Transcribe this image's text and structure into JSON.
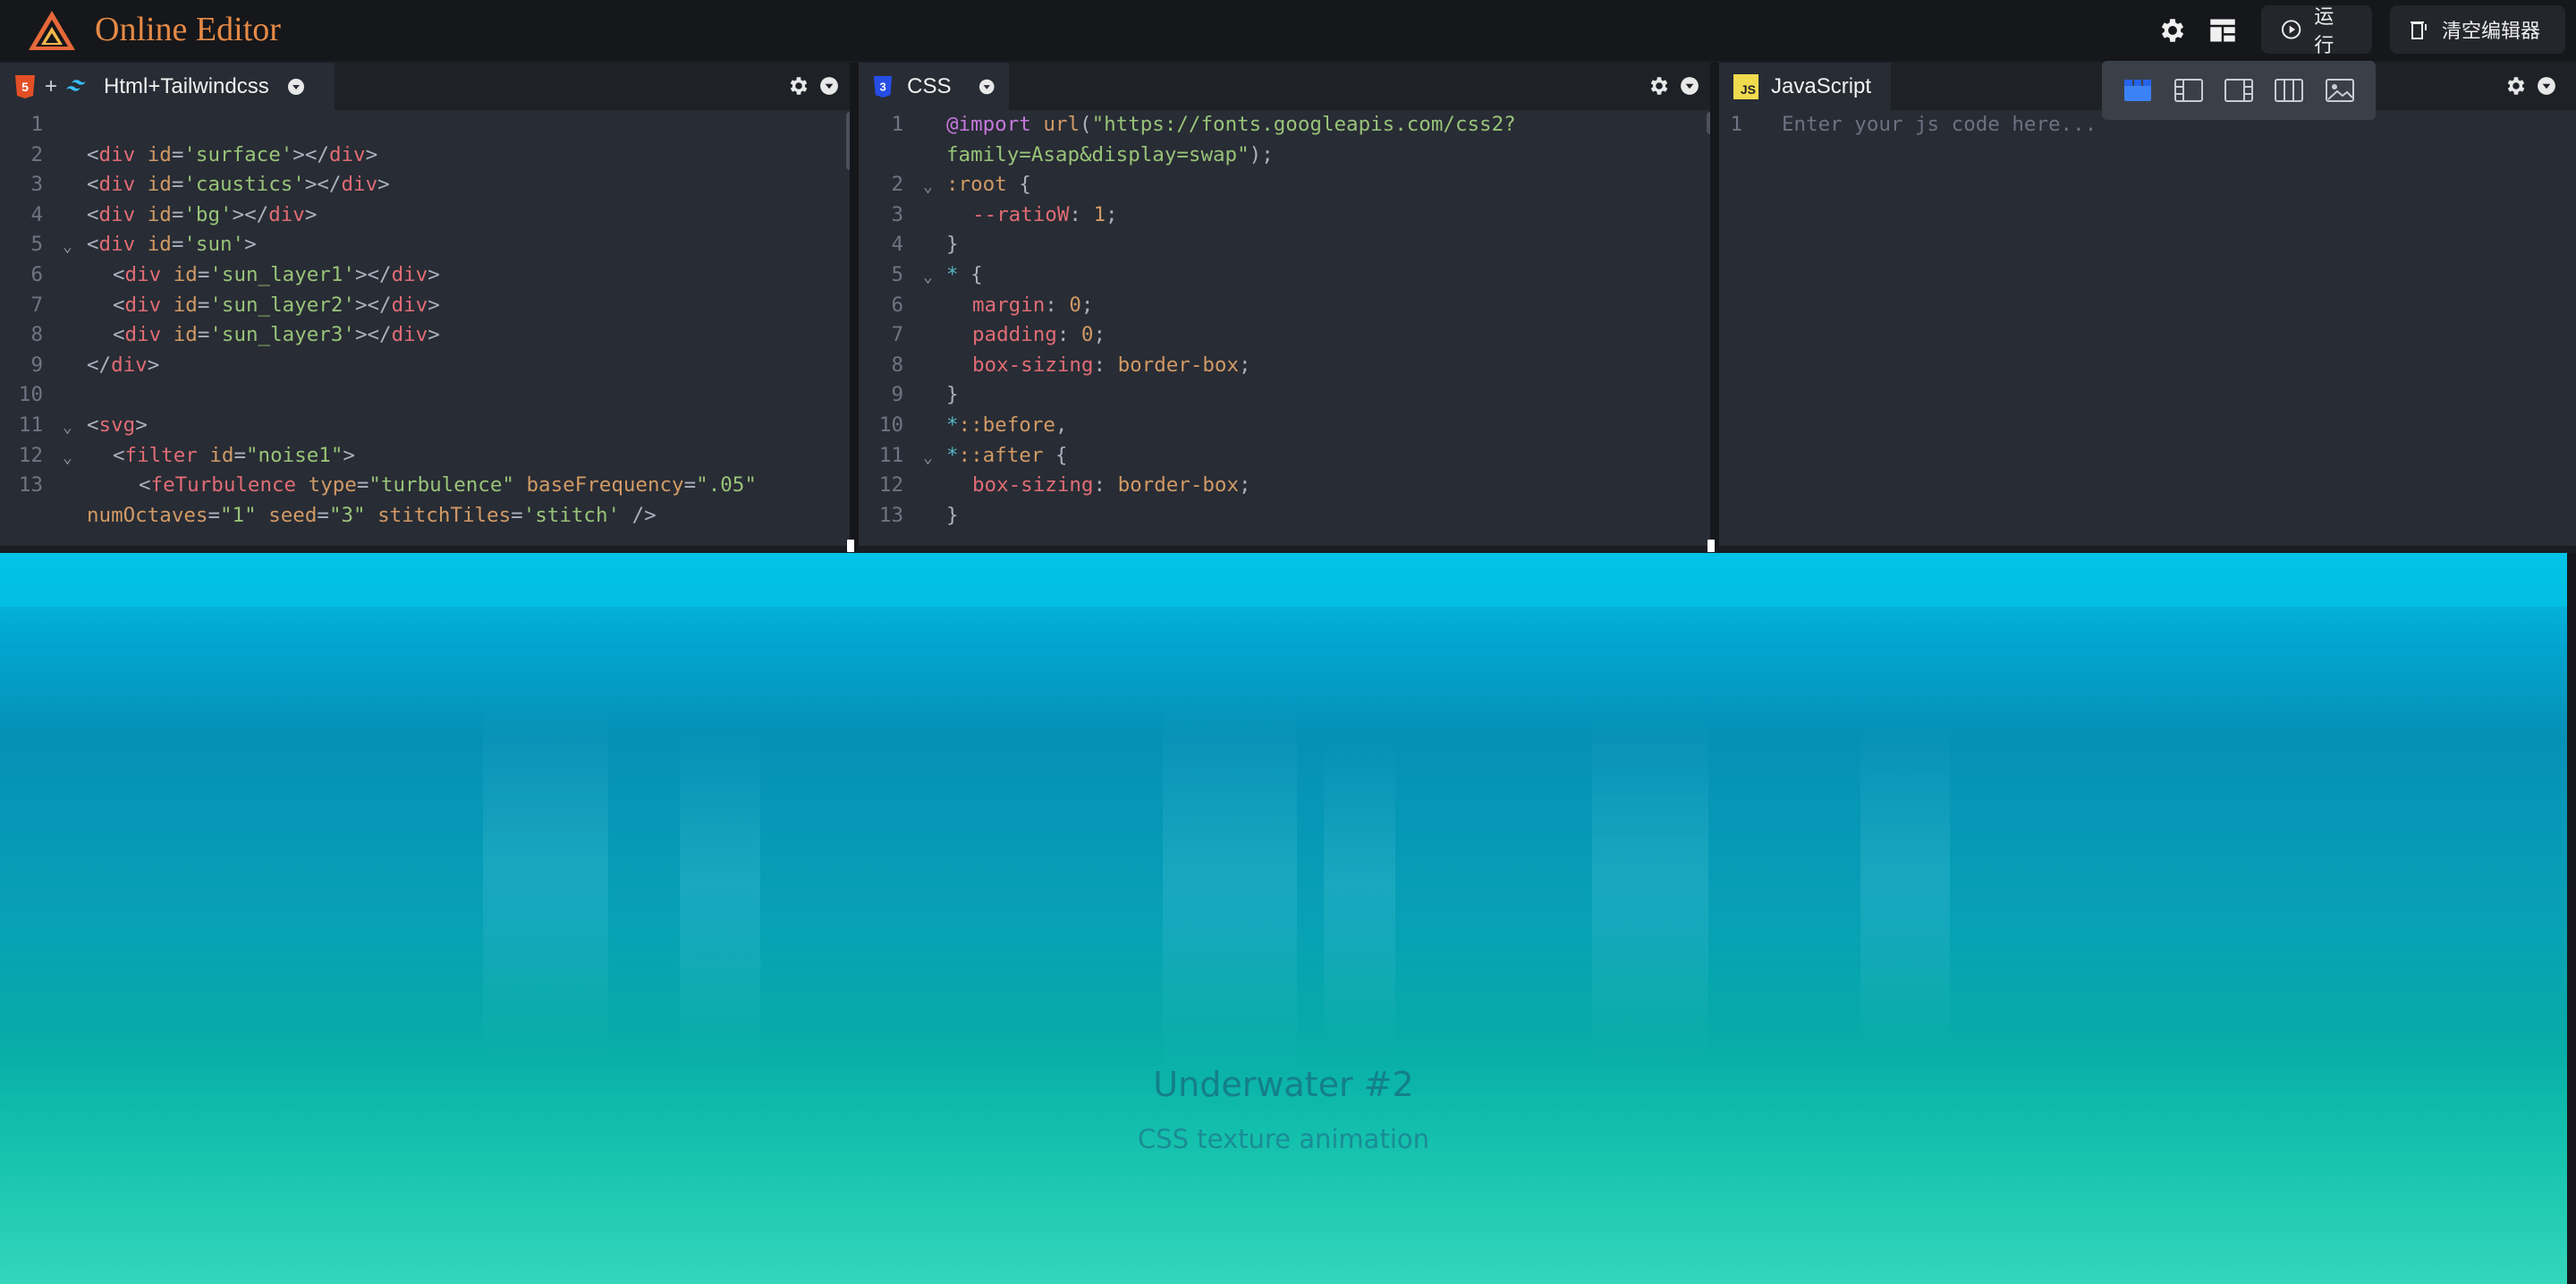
{
  "app": {
    "title": "Online Editor"
  },
  "toolbar": {
    "run_label": "运行",
    "clear_label": "清空编辑器"
  },
  "html_panel": {
    "tab_plus": "+",
    "tab_label": "Html+Tailwindcss",
    "lines": [
      {
        "n": "1",
        "indent": 0,
        "fold": false,
        "parts": []
      },
      {
        "n": "2",
        "indent": 0,
        "fold": false,
        "parts": [
          [
            "t-pun",
            "<"
          ],
          [
            "t-tag",
            "div"
          ],
          [
            "t-pun",
            " "
          ],
          [
            "t-attr",
            "id"
          ],
          [
            "t-pun",
            "="
          ],
          [
            "t-str",
            "'surface'"
          ],
          [
            "t-pun",
            "></"
          ],
          [
            "t-tag",
            "div"
          ],
          [
            "t-pun",
            ">"
          ]
        ]
      },
      {
        "n": "3",
        "indent": 0,
        "fold": false,
        "parts": [
          [
            "t-pun",
            "<"
          ],
          [
            "t-tag",
            "div"
          ],
          [
            "t-pun",
            " "
          ],
          [
            "t-attr",
            "id"
          ],
          [
            "t-pun",
            "="
          ],
          [
            "t-str",
            "'caustics'"
          ],
          [
            "t-pun",
            "></"
          ],
          [
            "t-tag",
            "div"
          ],
          [
            "t-pun",
            ">"
          ]
        ]
      },
      {
        "n": "4",
        "indent": 0,
        "fold": false,
        "parts": [
          [
            "t-pun",
            "<"
          ],
          [
            "t-tag",
            "div"
          ],
          [
            "t-pun",
            " "
          ],
          [
            "t-attr",
            "id"
          ],
          [
            "t-pun",
            "="
          ],
          [
            "t-str",
            "'bg'"
          ],
          [
            "t-pun",
            "></"
          ],
          [
            "t-tag",
            "div"
          ],
          [
            "t-pun",
            ">"
          ]
        ]
      },
      {
        "n": "5",
        "indent": 0,
        "fold": true,
        "parts": [
          [
            "t-pun",
            "<"
          ],
          [
            "t-tag",
            "div"
          ],
          [
            "t-pun",
            " "
          ],
          [
            "t-attr",
            "id"
          ],
          [
            "t-pun",
            "="
          ],
          [
            "t-str",
            "'sun'"
          ],
          [
            "t-pun",
            ">"
          ]
        ]
      },
      {
        "n": "6",
        "indent": 1,
        "fold": false,
        "parts": [
          [
            "t-pun",
            "<"
          ],
          [
            "t-tag",
            "div"
          ],
          [
            "t-pun",
            " "
          ],
          [
            "t-attr",
            "id"
          ],
          [
            "t-pun",
            "="
          ],
          [
            "t-str",
            "'sun_layer1'"
          ],
          [
            "t-pun",
            "></"
          ],
          [
            "t-tag",
            "div"
          ],
          [
            "t-pun",
            ">"
          ]
        ]
      },
      {
        "n": "7",
        "indent": 1,
        "fold": false,
        "parts": [
          [
            "t-pun",
            "<"
          ],
          [
            "t-tag",
            "div"
          ],
          [
            "t-pun",
            " "
          ],
          [
            "t-attr",
            "id"
          ],
          [
            "t-pun",
            "="
          ],
          [
            "t-str",
            "'sun_layer2'"
          ],
          [
            "t-pun",
            "></"
          ],
          [
            "t-tag",
            "div"
          ],
          [
            "t-pun",
            ">"
          ]
        ]
      },
      {
        "n": "8",
        "indent": 1,
        "fold": false,
        "parts": [
          [
            "t-pun",
            "<"
          ],
          [
            "t-tag",
            "div"
          ],
          [
            "t-pun",
            " "
          ],
          [
            "t-attr",
            "id"
          ],
          [
            "t-pun",
            "="
          ],
          [
            "t-str",
            "'sun_layer3'"
          ],
          [
            "t-pun",
            "></"
          ],
          [
            "t-tag",
            "div"
          ],
          [
            "t-pun",
            ">"
          ]
        ]
      },
      {
        "n": "9",
        "indent": 0,
        "fold": false,
        "parts": [
          [
            "t-pun",
            "</"
          ],
          [
            "t-tag",
            "div"
          ],
          [
            "t-pun",
            ">"
          ]
        ]
      },
      {
        "n": "10",
        "indent": 0,
        "fold": false,
        "parts": []
      },
      {
        "n": "11",
        "indent": 0,
        "fold": true,
        "parts": [
          [
            "t-pun",
            "<"
          ],
          [
            "t-tag",
            "svg"
          ],
          [
            "t-pun",
            ">"
          ]
        ]
      },
      {
        "n": "12",
        "indent": 1,
        "fold": true,
        "parts": [
          [
            "t-pun",
            "<"
          ],
          [
            "t-tag",
            "filter"
          ],
          [
            "t-pun",
            " "
          ],
          [
            "t-attr",
            "id"
          ],
          [
            "t-pun",
            "="
          ],
          [
            "t-str",
            "\"noise1\""
          ],
          [
            "t-pun",
            ">"
          ]
        ]
      },
      {
        "n": "13",
        "indent": 2,
        "fold": false,
        "parts": [
          [
            "t-pun",
            "<"
          ],
          [
            "t-tag",
            "feTurbulence"
          ],
          [
            "t-pun",
            " "
          ],
          [
            "t-attr",
            "type"
          ],
          [
            "t-pun",
            "="
          ],
          [
            "t-str",
            "\"turbulence\""
          ],
          [
            "t-pun",
            " "
          ],
          [
            "t-attr",
            "baseFrequency"
          ],
          [
            "t-pun",
            "="
          ],
          [
            "t-str",
            "\".05\""
          ]
        ]
      },
      {
        "n": "",
        "indent": 0,
        "fold": false,
        "parts": [
          [
            "t-attr",
            "numOctaves"
          ],
          [
            "t-pun",
            "="
          ],
          [
            "t-str",
            "\"1\""
          ],
          [
            "t-pun",
            " "
          ],
          [
            "t-attr",
            "seed"
          ],
          [
            "t-pun",
            "="
          ],
          [
            "t-str",
            "\"3\""
          ],
          [
            "t-pun",
            " "
          ],
          [
            "t-attr",
            "stitchTiles"
          ],
          [
            "t-pun",
            "="
          ],
          [
            "t-str",
            "'stitch'"
          ],
          [
            "t-pun",
            " />"
          ]
        ]
      }
    ]
  },
  "css_panel": {
    "tab_label": "CSS",
    "lines": [
      {
        "n": "1",
        "indent": 0,
        "fold": false,
        "parts": [
          [
            "t-kw",
            "@import"
          ],
          [
            "t-pun",
            " "
          ],
          [
            "t-sel",
            "url"
          ],
          [
            "t-pun",
            "("
          ],
          [
            "t-str",
            "\"https://fonts.googleapis.com/css2?"
          ]
        ]
      },
      {
        "n": "",
        "indent": 0,
        "fold": false,
        "parts": [
          [
            "t-str",
            "family=Asap&display=swap\""
          ],
          [
            "t-pun",
            ");"
          ]
        ]
      },
      {
        "n": "2",
        "indent": 0,
        "fold": true,
        "parts": [
          [
            "t-sel",
            ":root"
          ],
          [
            "t-pun",
            " {"
          ]
        ]
      },
      {
        "n": "3",
        "indent": 1,
        "fold": false,
        "parts": [
          [
            "t-prop",
            "--ratioW"
          ],
          [
            "t-pun",
            ": "
          ],
          [
            "t-num",
            "1"
          ],
          [
            "t-pun",
            ";"
          ]
        ]
      },
      {
        "n": "4",
        "indent": 0,
        "fold": false,
        "parts": [
          [
            "t-pun",
            "}"
          ]
        ]
      },
      {
        "n": "5",
        "indent": 0,
        "fold": true,
        "parts": [
          [
            "t-uni",
            "*"
          ],
          [
            "t-pun",
            " {"
          ]
        ]
      },
      {
        "n": "6",
        "indent": 1,
        "fold": false,
        "parts": [
          [
            "t-prop",
            "margin"
          ],
          [
            "t-pun",
            ": "
          ],
          [
            "t-num",
            "0"
          ],
          [
            "t-pun",
            ";"
          ]
        ]
      },
      {
        "n": "7",
        "indent": 1,
        "fold": false,
        "parts": [
          [
            "t-prop",
            "padding"
          ],
          [
            "t-pun",
            ": "
          ],
          [
            "t-num",
            "0"
          ],
          [
            "t-pun",
            ";"
          ]
        ]
      },
      {
        "n": "8",
        "indent": 1,
        "fold": false,
        "parts": [
          [
            "t-prop",
            "box-sizing"
          ],
          [
            "t-pun",
            ": "
          ],
          [
            "t-num",
            "border-box"
          ],
          [
            "t-pun",
            ";"
          ]
        ]
      },
      {
        "n": "9",
        "indent": 0,
        "fold": false,
        "parts": [
          [
            "t-pun",
            "}"
          ]
        ]
      },
      {
        "n": "10",
        "indent": 0,
        "fold": false,
        "parts": [
          [
            "t-uni",
            "*"
          ],
          [
            "t-sel",
            "::before"
          ],
          [
            "t-pun",
            ","
          ]
        ]
      },
      {
        "n": "11",
        "indent": 0,
        "fold": true,
        "parts": [
          [
            "t-uni",
            "*"
          ],
          [
            "t-sel",
            "::after"
          ],
          [
            "t-pun",
            " {"
          ]
        ]
      },
      {
        "n": "12",
        "indent": 1,
        "fold": false,
        "parts": [
          [
            "t-prop",
            "box-sizing"
          ],
          [
            "t-pun",
            ": "
          ],
          [
            "t-num",
            "border-box"
          ],
          [
            "t-pun",
            ";"
          ]
        ]
      },
      {
        "n": "13",
        "indent": 0,
        "fold": false,
        "parts": [
          [
            "t-pun",
            "}"
          ]
        ]
      }
    ]
  },
  "js_panel": {
    "tab_label": "JavaScript",
    "js_badge": "JS",
    "lines": [
      {
        "n": "1",
        "indent": 0,
        "fold": false,
        "parts": [
          [
            "t-ph",
            "Enter your js code here..."
          ]
        ]
      }
    ]
  },
  "preview": {
    "title": "Underwater #2",
    "subtitle": "CSS texture animation"
  },
  "colors": {
    "brand": "#e58a46",
    "panel_bg": "#282c34",
    "accent": "#3b82f6"
  }
}
